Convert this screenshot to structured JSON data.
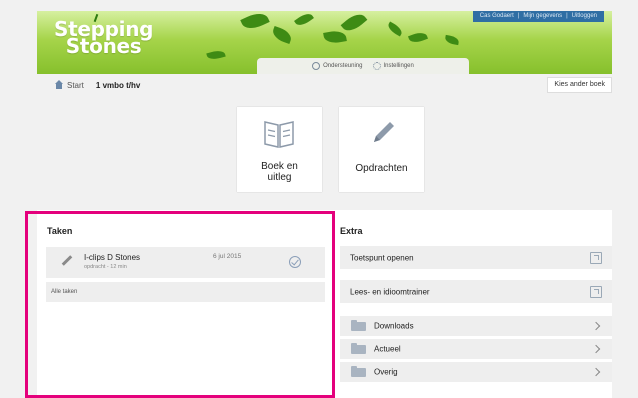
{
  "brand": {
    "logo_line1": "Stepping",
    "logo_line2": "Stones"
  },
  "usermenu": {
    "user": "Cas Godaert",
    "data": "Mijn gegevens",
    "logout": "Uitloggen",
    "sep": "|"
  },
  "tabs": {
    "support": "Ondersteuning",
    "settings": "Instellingen"
  },
  "breadcrumb": {
    "start": "Start",
    "current": "1 vmbo t/hv"
  },
  "other_book": "Kies ander boek",
  "tiles": {
    "book_line1": "Boek en",
    "book_line2": "uitleg",
    "tasks": "Opdrachten"
  },
  "tasks_section": {
    "title": "Taken",
    "task": {
      "title": "I-clips D Stones",
      "sub": "opdracht - 12 min",
      "date": "6 jul 2015"
    },
    "all_tasks": "Alle taken"
  },
  "extra_section": {
    "title": "Extra",
    "links": [
      "Toetspunt openen",
      "Lees- en idioomtrainer"
    ],
    "folders": [
      "Downloads",
      "Actueel",
      "Overig"
    ]
  },
  "colors": {
    "highlight": "#e4007c",
    "brand_green": "#86c02c",
    "usermenu_blue": "#2f6ea4"
  },
  "icons": [
    "home-icon",
    "book-icon",
    "pencil-icon",
    "check-circle-icon",
    "external-link-icon",
    "folder-icon",
    "chevron-right-icon"
  ]
}
